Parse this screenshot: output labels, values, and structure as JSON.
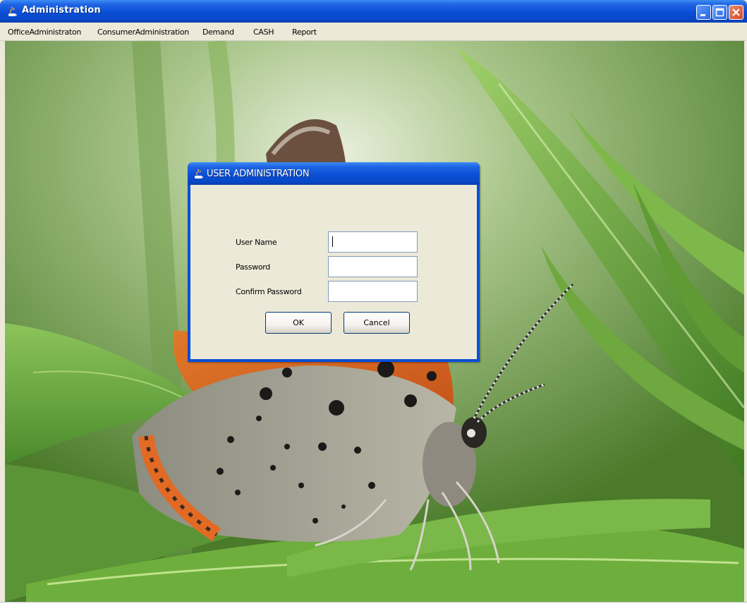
{
  "window": {
    "title": "Administration"
  },
  "menu": [
    "OfficeAdministraton",
    "ConsumerAdministration",
    "Demand",
    "CASH",
    "Report"
  ],
  "dialog": {
    "title": "USER ADMINISTRATION",
    "fields": [
      {
        "label": "User Name",
        "value": ""
      },
      {
        "label": "Password",
        "value": ""
      },
      {
        "label": "Confirm Password",
        "value": ""
      }
    ],
    "ok_label": "OK",
    "cancel_label": "Cancel"
  },
  "icons": {
    "app": "java-cup-icon",
    "minimize": "minimize-icon",
    "maximize": "maximize-icon",
    "close": "close-icon"
  },
  "colors": {
    "title_bar": "#0a4fd6",
    "dialog_face": "#ece9d8",
    "close_button": "#d44a26"
  }
}
